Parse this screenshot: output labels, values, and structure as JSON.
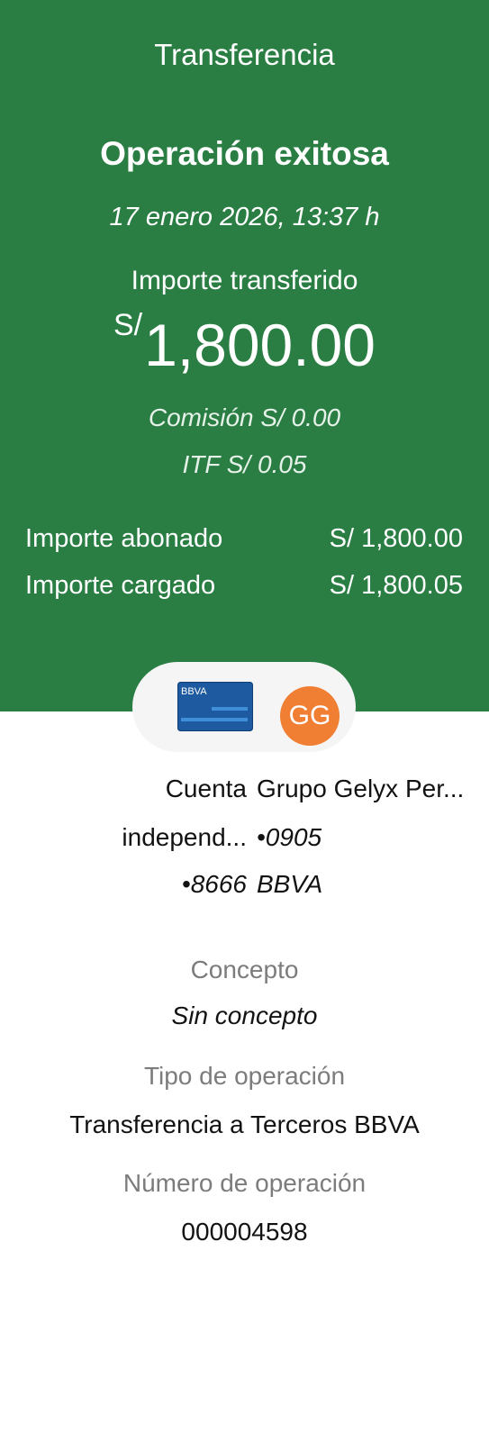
{
  "header": {
    "screen_title": "Transferencia",
    "status": "Operación exitosa",
    "datetime": "17 enero 2026, 13:37 h",
    "amount_label": "Importe transferido",
    "currency_symbol": "S/",
    "amount": "1,800.00",
    "commission": "Comisión  S/ 0.00",
    "itf": "ITF  S/ 0.05",
    "summary": [
      {
        "label": "Importe abonado",
        "value": "S/ 1,800.00"
      },
      {
        "label": "Importe cargado",
        "value": "S/ 1,800.05"
      }
    ]
  },
  "parties": {
    "origin": {
      "card_brand": "BBVA",
      "lines": [
        "Cuenta",
        "independ...",
        "•8666"
      ]
    },
    "destination": {
      "initials": "GG",
      "lines": [
        "Grupo Gelyx Per...",
        "•0905",
        "BBVA"
      ]
    }
  },
  "details": {
    "concept_label": "Concepto",
    "concept_value": "Sin concepto",
    "operation_type_label": "Tipo de operación",
    "operation_type_value": "Transferencia a Terceros BBVA",
    "operation_number_label": "Número de operación",
    "operation_number_value": "000004598"
  },
  "colors": {
    "header_bg": "#2a7e43",
    "avatar_bg": "#f07f34",
    "card_bg": "#1d5a9f",
    "pill_bg": "#f5f5f5"
  }
}
